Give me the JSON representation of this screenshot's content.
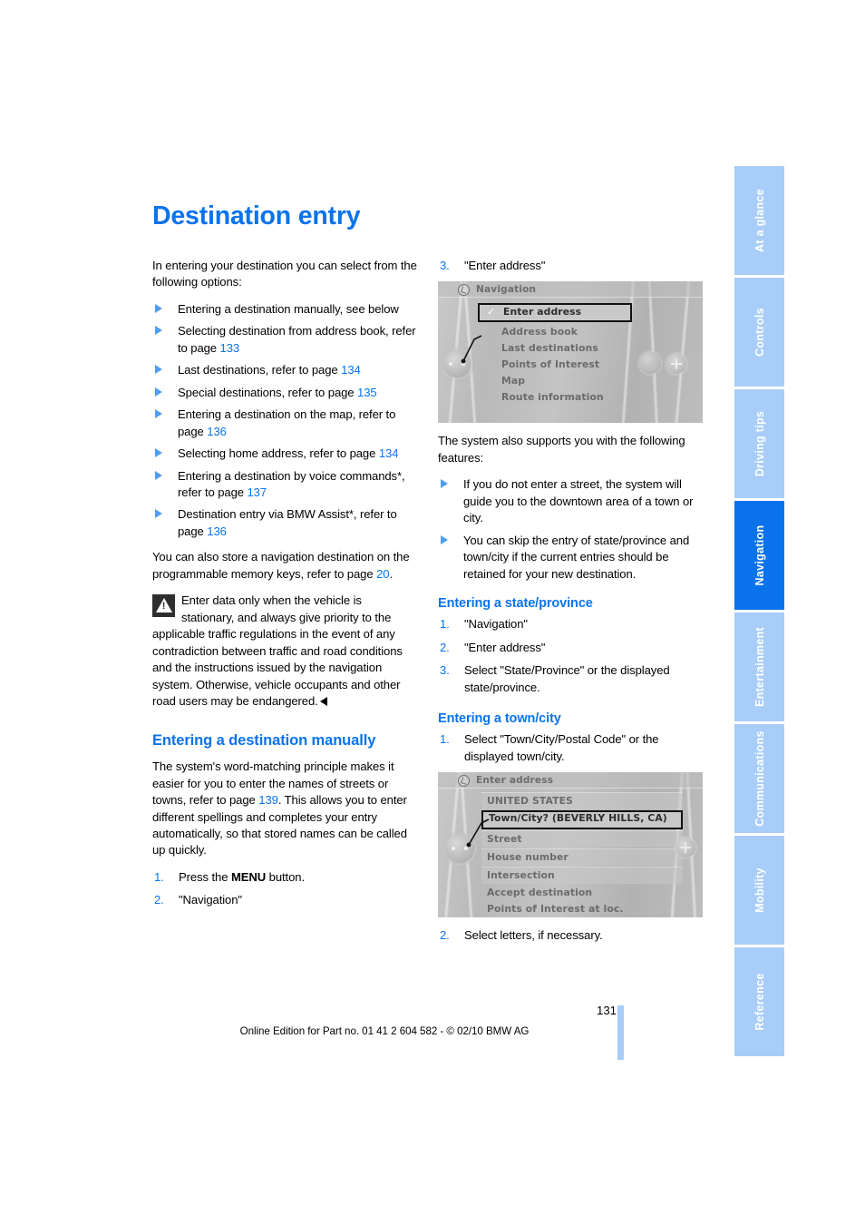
{
  "page": {
    "number": "131",
    "footer": "Online Edition for Part no. 01 41 2 604 582 - © 02/10 BMW AG",
    "accent_color": "#0a73ec",
    "tab_inactive_color": "#a9cdf9"
  },
  "title": "Destination entry",
  "sidebar": {
    "tabs": [
      {
        "label": "At a glance",
        "active": false
      },
      {
        "label": "Controls",
        "active": false
      },
      {
        "label": "Driving tips",
        "active": false
      },
      {
        "label": "Navigation",
        "active": true
      },
      {
        "label": "Entertainment",
        "active": false
      },
      {
        "label": "Communications",
        "active": false
      },
      {
        "label": "Mobility",
        "active": false
      },
      {
        "label": "Reference",
        "active": false
      }
    ]
  },
  "left_column": {
    "intro": "In entering your destination you can select from the following options:",
    "options": [
      {
        "text": "Entering a destination manually, see below",
        "page": ""
      },
      {
        "text": "Selecting destination from address book, refer to page ",
        "page": "133"
      },
      {
        "text": "Last destinations, refer to page ",
        "page": "134"
      },
      {
        "text": "Special destinations, refer to page ",
        "page": "135"
      },
      {
        "text": "Entering a destination on the map, refer to page ",
        "page": "136"
      },
      {
        "text": "Selecting home address, refer to page ",
        "page": "134"
      },
      {
        "text": "Entering a destination by voice commands*, refer to page ",
        "page": "137"
      },
      {
        "text": "Destination entry via BMW Assist*, refer to page ",
        "page": "136"
      }
    ],
    "memory_keys_text_pre": "You can also store a navigation destination on the programmable memory keys, refer to page ",
    "memory_keys_page": "20",
    "memory_keys_text_post": ".",
    "warning": "Enter data only when the vehicle is stationary, and always give priority to the applicable traffic regulations in the event of any contradiction between traffic and road conditions and the instructions issued by the navigation system. Otherwise, vehicle occupants and other road users may be endangered.",
    "manual_heading": "Entering a destination manually",
    "manual_body_pre": "The system's word-matching principle makes it easier for you to enter the names of streets or towns, refer to page ",
    "manual_body_page": "139",
    "manual_body_post": ". This allows you to enter different spellings and completes your entry automatically, so that stored names can be called up quickly.",
    "manual_steps": [
      {
        "num": "1.",
        "text_pre": "Press the ",
        "bold": "MENU",
        "text_post": " button."
      },
      {
        "num": "2.",
        "text_pre": "\"Navigation\"",
        "bold": "",
        "text_post": ""
      }
    ]
  },
  "right_column": {
    "step3": {
      "num": "3.",
      "text": "\"Enter address\""
    },
    "nav_screenshot": {
      "header_title": "Navigation",
      "header_icon": "navigation-compass-icon",
      "items": [
        {
          "label": "Enter address",
          "selected": true,
          "checked": true
        },
        {
          "label": "Address book",
          "selected": false,
          "checked": false
        },
        {
          "label": "Last destinations",
          "selected": false,
          "checked": false
        },
        {
          "label": "Points of Interest",
          "selected": false,
          "checked": false
        },
        {
          "label": "Map",
          "selected": false,
          "checked": false
        },
        {
          "label": "Route information",
          "selected": false,
          "checked": false
        }
      ]
    },
    "features_intro": "The system also supports you with the following features:",
    "features": [
      "If you do not enter a street, the system will guide you to the downtown area of a town or city.",
      "You can skip the entry of state/province and town/city if the current entries should be retained for your new destination."
    ],
    "state_heading": "Entering a state/province",
    "state_steps": [
      {
        "num": "1.",
        "text": "\"Navigation\""
      },
      {
        "num": "2.",
        "text": "\"Enter address\""
      },
      {
        "num": "3.",
        "text": "Select \"State/Province\" or the displayed state/province."
      }
    ],
    "town_heading": "Entering a town/city",
    "town_step1": {
      "num": "1.",
      "text": "Select \"Town/City/Postal Code\" or the displayed town/city."
    },
    "address_screenshot": {
      "header_title": "Enter address",
      "header_icon": "enter-address-icon",
      "items": [
        {
          "label": "UNITED STATES",
          "selected": false,
          "plate": true
        },
        {
          "label": "Town/City? (BEVERLY HILLS, CA)",
          "selected": true,
          "plate": true
        },
        {
          "label": "Street",
          "selected": false,
          "plate": true
        },
        {
          "label": "House number",
          "selected": false,
          "plate": true
        },
        {
          "label": "Intersection",
          "selected": false,
          "plate": true
        },
        {
          "label": "Accept destination",
          "selected": false,
          "plate": false
        },
        {
          "label": "Points of Interest at loc.",
          "selected": false,
          "plate": false
        }
      ]
    },
    "town_step2": {
      "num": "2.",
      "text": "Select letters, if necessary."
    }
  }
}
